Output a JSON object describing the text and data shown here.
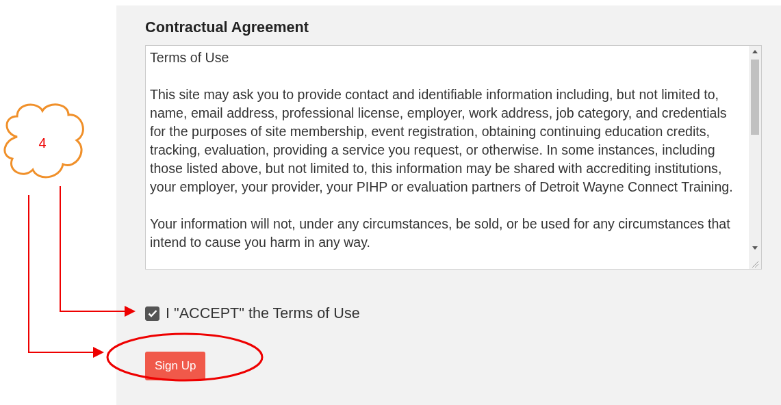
{
  "section": {
    "title": "Contractual Agreement"
  },
  "terms": {
    "paragraphs": [
      "Terms of Use",
      "This site may ask you to provide contact and identifiable information including, but not limited to, name, email address, professional license, employer, work address, job category, and credentials for the purposes of site membership, event registration, obtaining continuing education credits, tracking, evaluation, providing a service you request, or otherwise. In some instances, including those listed above, but not limited to, this information may be shared with accrediting institutions, your employer, your provider, your PIHP or evaluation partners of Detroit Wayne Connect Training.",
      "Your information will not, under any circumstances, be sold, or be used for any circumstances that intend to cause you harm in any way."
    ]
  },
  "accept": {
    "label": "I \"ACCEPT\" the Terms of Use",
    "checked": true
  },
  "buttons": [
    {
      "label": "Sign Up"
    }
  ],
  "annotation": {
    "label": "4"
  }
}
